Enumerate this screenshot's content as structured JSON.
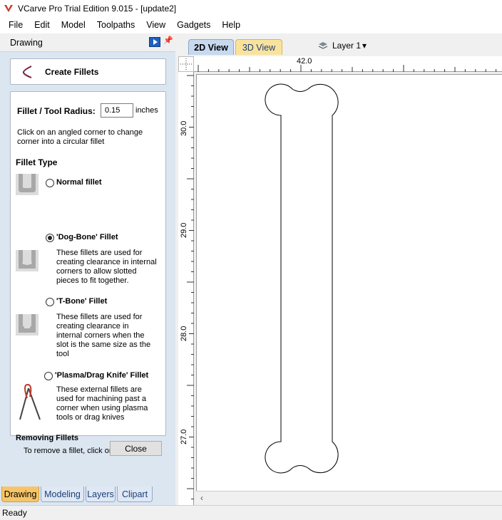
{
  "window": {
    "title": "VCarve Pro Trial Edition 9.015 - [update2]"
  },
  "menu": [
    "File",
    "Edit",
    "Model",
    "Toolpaths",
    "View",
    "Gadgets",
    "Help"
  ],
  "pane": {
    "title": "Drawing"
  },
  "form": {
    "title": "Create Fillets",
    "radius_label": "Fillet / Tool Radius:",
    "radius_value": "0.15",
    "radius_unit": "inches",
    "instruction": "Click on an angled corner to change corner into a circular fillet",
    "fillet_type_heading": "Fillet Type",
    "options": [
      {
        "label": "Normal fillet",
        "selected": false,
        "description": ""
      },
      {
        "label": "'Dog-Bone' Fillet",
        "selected": true,
        "description": "These fillets are used for creating clearance in internal corners to allow slotted pieces to fit together."
      },
      {
        "label": "'T-Bone' Fillet",
        "selected": false,
        "description": "These fillets are used for creating clearance in internal corners when the slot is the same size as the tool"
      },
      {
        "label": "'Plasma/Drag Knife' Fillet",
        "selected": false,
        "description": "These external fillets are used for machining past a corner when using plasma tools or drag knives"
      }
    ],
    "removing_heading": "Removing Fillets",
    "removing_text": "To remove a fillet, click on the fillet arc.",
    "close_label": "Close"
  },
  "bottom_tabs": [
    "Drawing",
    "Modeling",
    "Layers",
    "Clipart"
  ],
  "view_tabs": [
    "2D View",
    "3D View"
  ],
  "layer": {
    "label": "Layer 1",
    "arrow": "▾"
  },
  "ruler": {
    "top_label": "42.0",
    "left_labels": [
      "30.0",
      "29.0",
      "28.0",
      "27.0"
    ]
  },
  "status": "Ready",
  "colors": {
    "pane_bg": "#dce6f1",
    "active_tab": "#f7c568",
    "view2d_tab": "#c6d9ef",
    "view3d_tab": "#f9e39c"
  }
}
